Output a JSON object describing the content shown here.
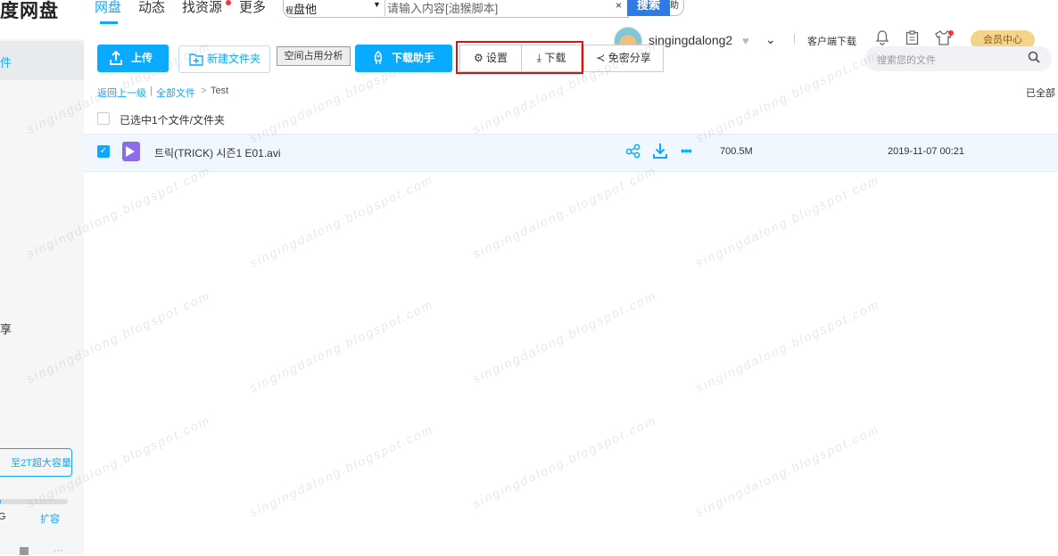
{
  "nav": {
    "logo": "度网盘",
    "items": [
      {
        "label": "网盘",
        "active": true
      },
      {
        "label": "动态"
      },
      {
        "label": "找资源"
      },
      {
        "label": "更多"
      }
    ]
  },
  "search": {
    "scope_prefix": "程",
    "scope": "盘他",
    "placeholder": "请输入内容[油猴脚本]",
    "clear": "×",
    "button": "搜索",
    "tail": "助"
  },
  "user": {
    "name": "singingdalong2",
    "client_download": "客户端下载",
    "member_center": "会员中心",
    "file_search_placeholder": "搜索您的文件"
  },
  "sidebar": {
    "active_item": "件",
    "share_item": "享",
    "upgrade": "至2T超大容量",
    "quota_text": "G",
    "quota_fraction": 0.06,
    "expand": "扩容"
  },
  "toolbar": {
    "upload": "上传",
    "new_folder": "新建文件夹",
    "space_analysis": "空间占用分析",
    "download_helper": "下载助手",
    "settings": "设置",
    "download": "下载",
    "secret_share": "免密分享"
  },
  "breadcrumb": {
    "back": "返回上一级",
    "all_files": "全部文件",
    "sep": ">",
    "current": "Test",
    "right": "已全部"
  },
  "selection": {
    "label": "已选中1个文件/文件夹"
  },
  "files": [
    {
      "name": "트릭(TRICK) 시즌1 E01.avi",
      "size": "700.5M",
      "date": "2019-11-07 00:21",
      "checked": true
    }
  ],
  "watermark": "singingdalong.blogspot.com",
  "colors": {
    "accent": "#09aaff",
    "highlight_box": "#e01010",
    "member": "#f4d38a"
  }
}
